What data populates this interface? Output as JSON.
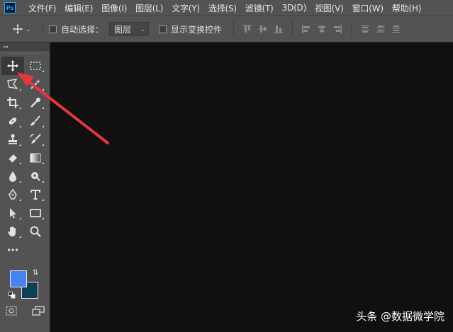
{
  "app": {
    "logo_text": "Ps"
  },
  "menu": [
    "文件(F)",
    "编辑(E)",
    "图像(I)",
    "图层(L)",
    "文字(Y)",
    "选择(S)",
    "滤镜(T)",
    "3D(D)",
    "视图(V)",
    "窗口(W)",
    "帮助(H)"
  ],
  "options_bar": {
    "auto_select_label": "自动选择：",
    "auto_select_checked": false,
    "target_value": "图层",
    "show_transform_label": "显示变换控件",
    "show_transform_checked": false
  },
  "tool_panel": {
    "collapse_glyph": "◂◂"
  },
  "colors": {
    "foreground": "#4783f5",
    "background": "#0e3f55",
    "annotation_arrow": "#e8363b"
  },
  "watermark": "头条 @数据微学院"
}
